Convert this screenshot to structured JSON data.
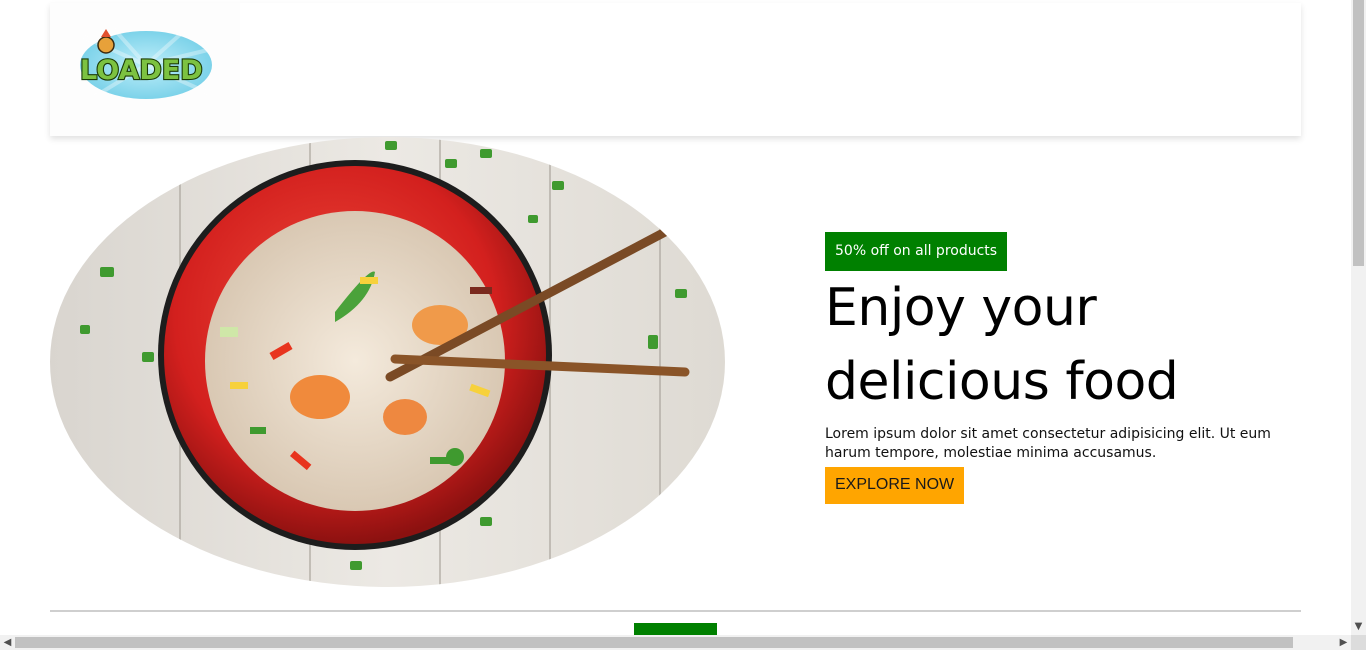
{
  "header": {
    "logo_text": "LOADED"
  },
  "hero": {
    "image_icon": "noodle-bowl-image",
    "badge": "50% off on all products",
    "headline": "Enjoy your delicious food",
    "description": "Lorem ipsum dolor sit amet consectetur adipisicing elit. Ut eum harum tempore, molestiae minima accusamus.",
    "cta_label": "EXPLORE NOW"
  },
  "colors": {
    "accent_green": "#008000",
    "cta_orange": "#ffa500",
    "logo_sky": "#7fd6ec",
    "logo_green": "#5fb02a"
  },
  "scrollbars": {
    "up": "▲",
    "down": "▼",
    "left": "◀",
    "right": "▶"
  }
}
